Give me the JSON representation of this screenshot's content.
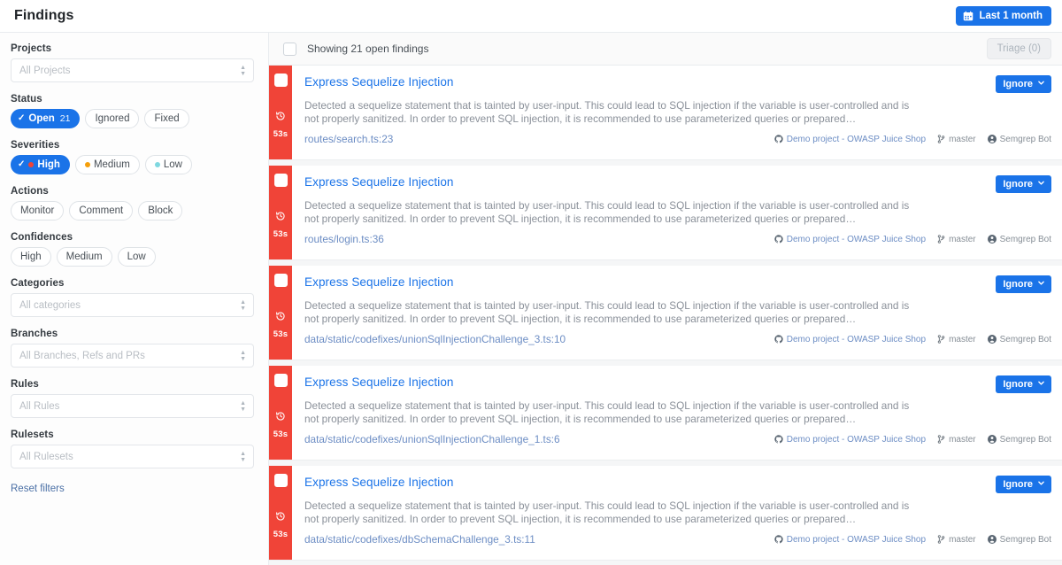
{
  "header": {
    "title": "Findings",
    "date_filter": {
      "label": "Last 1 month",
      "icon": "calendar-icon"
    }
  },
  "sidebar": {
    "projects": {
      "label": "Projects",
      "placeholder": "All Projects"
    },
    "status": {
      "label": "Status",
      "options": [
        {
          "label": "Open",
          "count": "21",
          "active": true
        },
        {
          "label": "Ignored",
          "count": "",
          "active": false
        },
        {
          "label": "Fixed",
          "count": "",
          "active": false
        }
      ]
    },
    "severities": {
      "label": "Severities",
      "options": [
        {
          "label": "High",
          "active": true,
          "color": "#f04438"
        },
        {
          "label": "Medium",
          "active": false,
          "color": "#f59f0b"
        },
        {
          "label": "Low",
          "active": false,
          "color": "#7fd8e0"
        }
      ]
    },
    "actions": {
      "label": "Actions",
      "options": [
        {
          "label": "Monitor"
        },
        {
          "label": "Comment"
        },
        {
          "label": "Block"
        }
      ]
    },
    "confidences": {
      "label": "Confidences",
      "options": [
        {
          "label": "High"
        },
        {
          "label": "Medium"
        },
        {
          "label": "Low"
        }
      ]
    },
    "categories": {
      "label": "Categories",
      "placeholder": "All categories"
    },
    "branches": {
      "label": "Branches",
      "placeholder": "All Branches, Refs and PRs"
    },
    "rules": {
      "label": "Rules",
      "placeholder": "All Rules"
    },
    "rulesets": {
      "label": "Rulesets",
      "placeholder": "All Rulesets"
    },
    "reset": "Reset filters"
  },
  "main": {
    "showing_text": "Showing 21 open findings",
    "triage_button": "Triage (0)",
    "select_all_checkbox": "",
    "findings": [
      {
        "title": "Express Sequelize Injection",
        "description": "Detected a sequelize statement that is tainted by user-input. This could lead to SQL injection if the variable is user-controlled and is not properly sanitized. In order to prevent SQL injection, it is recommended to use parameterized queries or prepared…",
        "filepath": "routes/search.ts:23",
        "age": "53s",
        "severity": "high",
        "severity_color": "#f04438",
        "action_label": "Ignore",
        "project": "Demo project - OWASP Juice Shop",
        "branch": "master",
        "author": "Semgrep Bot"
      },
      {
        "title": "Express Sequelize Injection",
        "description": "Detected a sequelize statement that is tainted by user-input. This could lead to SQL injection if the variable is user-controlled and is not properly sanitized. In order to prevent SQL injection, it is recommended to use parameterized queries or prepared…",
        "filepath": "routes/login.ts:36",
        "age": "53s",
        "severity": "high",
        "severity_color": "#f04438",
        "action_label": "Ignore",
        "project": "Demo project - OWASP Juice Shop",
        "branch": "master",
        "author": "Semgrep Bot"
      },
      {
        "title": "Express Sequelize Injection",
        "description": "Detected a sequelize statement that is tainted by user-input. This could lead to SQL injection if the variable is user-controlled and is not properly sanitized. In order to prevent SQL injection, it is recommended to use parameterized queries or prepared…",
        "filepath": "data/static/codefixes/unionSqlInjectionChallenge_3.ts:10",
        "age": "53s",
        "severity": "high",
        "severity_color": "#f04438",
        "action_label": "Ignore",
        "project": "Demo project - OWASP Juice Shop",
        "branch": "master",
        "author": "Semgrep Bot"
      },
      {
        "title": "Express Sequelize Injection",
        "description": "Detected a sequelize statement that is tainted by user-input. This could lead to SQL injection if the variable is user-controlled and is not properly sanitized. In order to prevent SQL injection, it is recommended to use parameterized queries or prepared…",
        "filepath": "data/static/codefixes/unionSqlInjectionChallenge_1.ts:6",
        "age": "53s",
        "severity": "high",
        "severity_color": "#f04438",
        "action_label": "Ignore",
        "project": "Demo project - OWASP Juice Shop",
        "branch": "master",
        "author": "Semgrep Bot"
      },
      {
        "title": "Express Sequelize Injection",
        "description": "Detected a sequelize statement that is tainted by user-input. This could lead to SQL injection if the variable is user-controlled and is not properly sanitized. In order to prevent SQL injection, it is recommended to use parameterized queries or prepared…",
        "filepath": "data/static/codefixes/dbSchemaChallenge_3.ts:11",
        "age": "53s",
        "severity": "high",
        "severity_color": "#f04438",
        "action_label": "Ignore",
        "project": "Demo project - OWASP Juice Shop",
        "branch": "master",
        "author": "Semgrep Bot"
      }
    ]
  }
}
